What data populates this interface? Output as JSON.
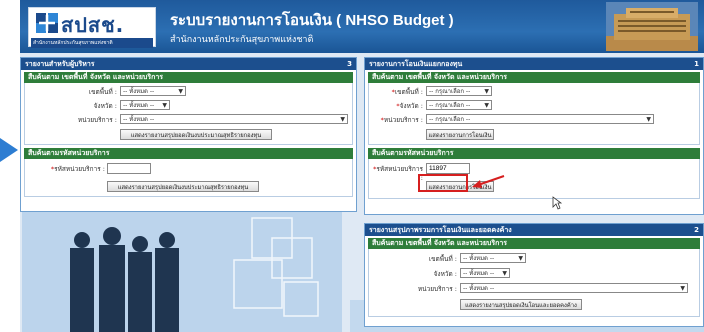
{
  "header": {
    "logo_text": "สปสช.",
    "logo_sub": "สำนักงานหลักประกันสุขภาพแห่งชาติ",
    "title": "ระบบรายงานการโอนเงิน ( NHSO Budget )",
    "subtitle": "สำนักงานหลักประกันสุขภาพแห่งชาติ"
  },
  "panel_admin": {
    "title": "รายงานสำหรับผู้บริหาร",
    "number": "3",
    "section1_title": "สืบค้นตาม เขตพื้นที่ จังหวัด และหน่วยบริการ",
    "region_label": "เขตพื้นที่ :",
    "region_value": "-- ทั้งหมด --",
    "province_label": "จังหวัด :",
    "province_value": "-- ทั้งหมด --",
    "unit_label": "หน่วยบริการ :",
    "unit_value": "-- ทั้งหมด --",
    "section1_button": "แสดงรายงานสรุปยอดเงินงบประมาณสุทธิรายกองทุน",
    "section2_title": "สืบค้นตามรหัสหน่วยบริการ",
    "code_label": "รหัสหน่วยบริการ :",
    "code_value": "",
    "section2_button": "แสดงรายงานสรุปยอดเงินงบประมาณสุทธิรายกองทุน"
  },
  "panel_fund": {
    "title": "รายงานการโอนเงินแยกกองทุน",
    "number": "1",
    "section1_title": "สืบค้นตาม เขตพื้นที่ จังหวัด และหน่วยบริการ",
    "region_label": "เขตพื้นที่ :",
    "region_value": "-- กรุณาเลือก --",
    "province_label": "จังหวัด :",
    "province_value": "-- กรุณาเลือก --",
    "unit_label": "หน่วยบริการ :",
    "unit_value": "-- กรุณาเลือก --",
    "section1_button": "แสดงรายงานการโอนเงิน",
    "section2_title": "สืบค้นตามรหัสหน่วยบริการ",
    "code_label": "รหัสหน่วยบริการ :",
    "code_value": "11897",
    "section2_button": "แสดงรายงานการโอนเงิน"
  },
  "panel_summary": {
    "title": "รายงานสรุปภาพรวมการโอนเงินและยอดคงค้าง",
    "number": "2",
    "section1_title": "สืบค้นตาม เขตพื้นที่ จังหวัด และหน่วยบริการ",
    "region_label": "เขตพื้นที่ :",
    "region_value": "-- ทั้งหมด --",
    "province_label": "จังหวัด :",
    "province_value": "-- ทั้งหมด --",
    "unit_label": "หน่วยบริการ :",
    "unit_value": "-- ทั้งหมด --",
    "section1_button": "แสดงรายงานสรุปยอดเงินโอนและยอดคงค้าง"
  },
  "colors": {
    "header_blue": "#1f5a9c",
    "panel_head": "#1c4f8e",
    "section_green": "#2e7d3a",
    "highlight_red": "#d61f1f"
  }
}
